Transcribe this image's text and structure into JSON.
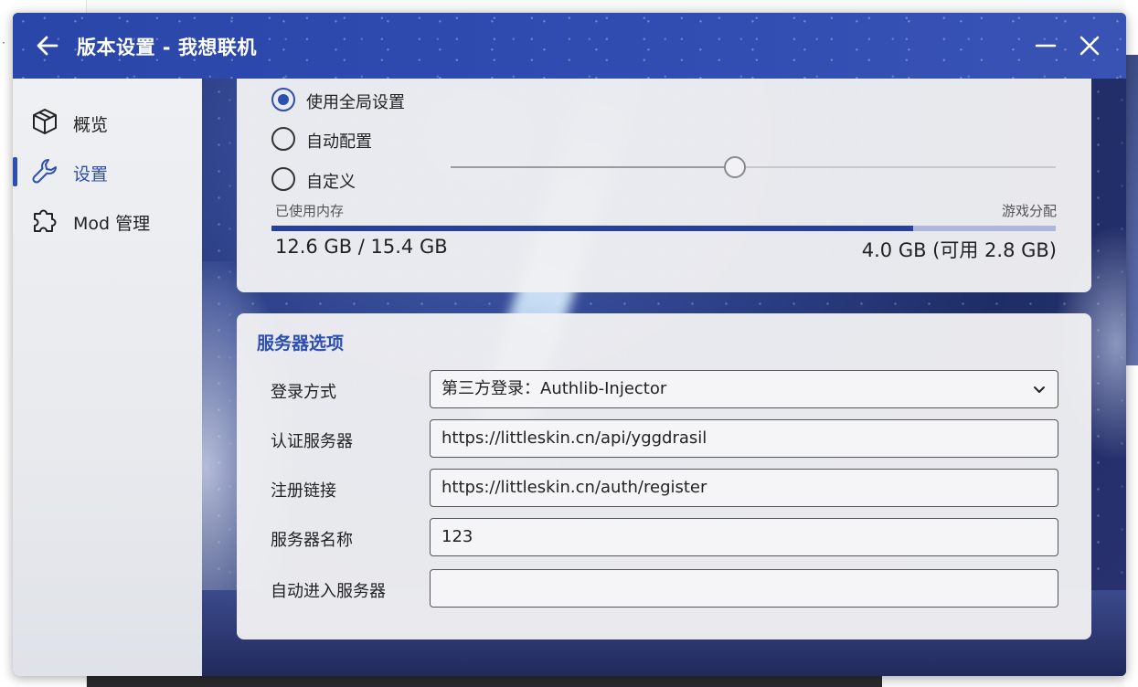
{
  "window": {
    "title": "版本设置 - 我想联机",
    "back_icon": "arrow-left-icon",
    "minimize_icon": "minimize-icon",
    "close_icon": "close-icon"
  },
  "sidebar": {
    "items": [
      {
        "label": "概览",
        "icon": "cube-icon",
        "active": false
      },
      {
        "label": "设置",
        "icon": "wrench-icon",
        "active": true
      },
      {
        "label": "Mod 管理",
        "icon": "puzzle-icon",
        "active": false
      }
    ]
  },
  "memory": {
    "options": [
      {
        "label": "使用全局设置",
        "checked": true
      },
      {
        "label": "自动配置",
        "checked": false
      },
      {
        "label": "自定义",
        "checked": false
      }
    ],
    "slider_fraction": 0.47,
    "used_label": "已使用内存",
    "alloc_label": "游戏分配",
    "used_value": "12.6 GB / 15.4 GB",
    "alloc_value": "4.0 GB (可用 2.8 GB)",
    "used_fraction": 0.818
  },
  "server": {
    "section_title": "服务器选项",
    "fields": [
      {
        "label": "登录方式",
        "value": "第三方登录：Authlib-Injector",
        "type": "select"
      },
      {
        "label": "认证服务器",
        "value": "https://littleskin.cn/api/yggdrasil",
        "type": "text"
      },
      {
        "label": "注册链接",
        "value": "https://littleskin.cn/auth/register",
        "type": "text"
      },
      {
        "label": "服务器名称",
        "value": "123",
        "type": "text"
      },
      {
        "label": "自动进入服务器",
        "value": "",
        "type": "text"
      }
    ]
  },
  "colors": {
    "accent": "#2c4fb0",
    "titlebar": "#2f4bb0",
    "memory_bar": "#25409e"
  }
}
